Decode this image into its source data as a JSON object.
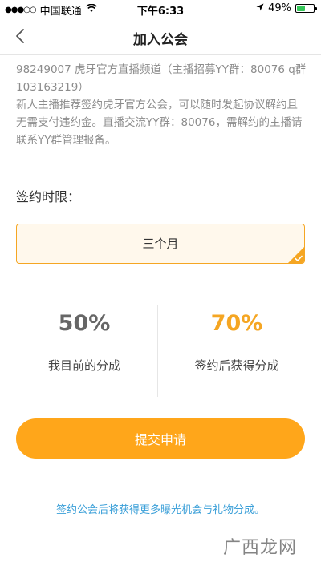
{
  "status_bar": {
    "signal": "●●●○○",
    "carrier": "中国联通",
    "wifi_icon": "wifi-icon",
    "time": "下午6:33",
    "location_icon": "location-arrow-icon",
    "battery_text": "49%",
    "battery_level": 0.49,
    "battery_color": "#35c759"
  },
  "nav": {
    "back_icon": "chevron-left-icon",
    "title": "加入公会"
  },
  "intro": {
    "line1": "98249007  虎牙官方直播频道（主播招募YY群：80076 q群103163219）",
    "line2": "新人主播推荐签约虎牙官方公会，可以随时发起协议解约且无需支付违约金。直播交流YY群：80076，需解约的主播请联系YY群管理报备。"
  },
  "term": {
    "label": "签约时限：",
    "selected": "三个月"
  },
  "share": {
    "current_value": "50%",
    "current_label": "我目前的分成",
    "after_value": "70%",
    "after_label": "签约后获得分成"
  },
  "submit_label": "提交申请",
  "footer_note": "签约公会后将获得更多曝光机会与礼物分成。",
  "watermark": "广西龙网",
  "colors": {
    "accent": "#ffa61a",
    "select_border": "#f5a623",
    "select_bg": "#fff8ec",
    "link": "#3a9fd8"
  }
}
